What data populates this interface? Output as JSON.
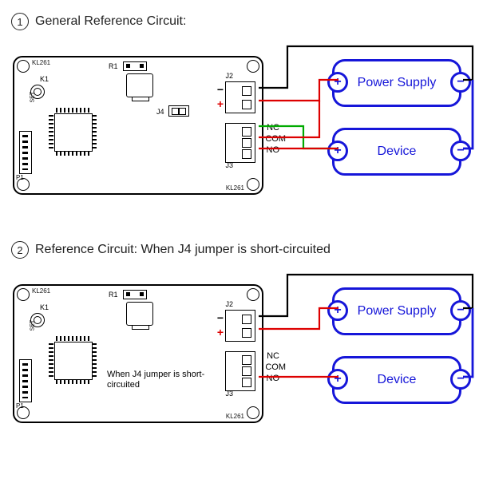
{
  "section1": {
    "num": "1",
    "title": "General Reference Circuit:",
    "board": "KL261",
    "labels": {
      "r1": "R1",
      "k1": "K1",
      "set": "SET",
      "p1": "P1",
      "j4": "J4",
      "j2": "J2",
      "j3": "J3",
      "minus": "−",
      "plus": "+",
      "nc": "NC",
      "com": "COM",
      "no": "NO"
    },
    "power": "Power Supply",
    "device": "Device",
    "plus_sym": "+",
    "minus_sym": "−"
  },
  "section2": {
    "num": "2",
    "title": "Reference Circuit: When J4 jumper is short-circuited",
    "note": "When J4 jumper is short-circuited",
    "board": "KL261",
    "labels": {
      "r1": "R1",
      "k1": "K1",
      "set": "SET",
      "p1": "P1",
      "j2": "J2",
      "j3": "J3",
      "minus": "−",
      "plus": "+",
      "nc": "NC",
      "com": "COM",
      "no": "NO"
    },
    "power": "Power Supply",
    "device": "Device",
    "plus_sym": "+",
    "minus_sym": "−"
  }
}
